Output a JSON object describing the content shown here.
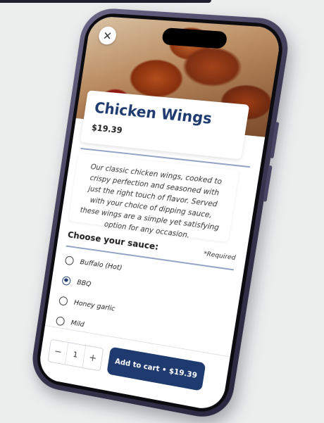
{
  "product": {
    "title": "Chicken Wings",
    "price": "$19.39",
    "description": "Our classic chicken wings, cooked to crispy perfection and seasoned with just the right touch of flavor. Served with your choice of dipping sauce, these wings are a simple yet satisfying option for any occasion."
  },
  "close": {
    "glyph": "✕"
  },
  "sauce": {
    "heading": "Choose your sauce:",
    "required_label": "*Required",
    "options": [
      {
        "label": "Buffalo (Hot)",
        "selected": false
      },
      {
        "label": "BBQ",
        "selected": true
      },
      {
        "label": "Honey garlic",
        "selected": false
      },
      {
        "label": "Mild",
        "selected": false
      }
    ]
  },
  "cart": {
    "quantity": "1",
    "minus": "−",
    "plus": "+",
    "add_label": "Add to cart • $19.39"
  },
  "colors": {
    "accent": "#1e3a6e",
    "phone_frame": "#4a4563"
  },
  "icons": {
    "close": "close-icon",
    "minus": "minus-icon",
    "plus": "plus-icon"
  }
}
